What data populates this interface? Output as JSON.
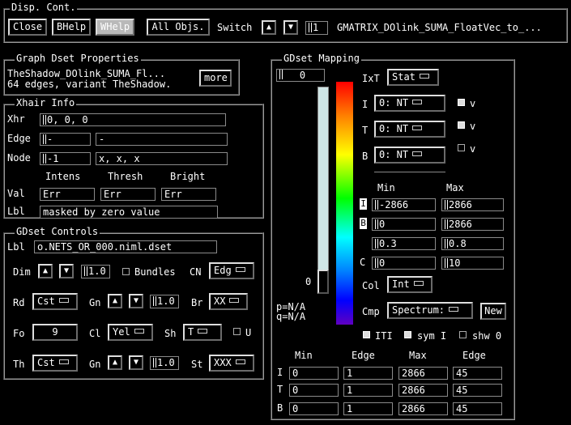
{
  "disp_cont": {
    "title": "Disp. Cont.",
    "close": "Close",
    "bhelp": "BHelp",
    "whelp": "WHelp",
    "all_objs": "All Objs.",
    "switch_label": "Switch",
    "switch_value": "1",
    "dataset_name": "GMATRIX_DOlink_SUMA_FloatVec_to_..."
  },
  "graph_props": {
    "title": "Graph Dset Properties",
    "line1": "TheShadow_DOlink_SUMA_Fl...",
    "line2": "64 edges, variant TheShadow.",
    "more": "more"
  },
  "xhair": {
    "title": "Xhair Info",
    "xhr_label": "Xhr",
    "xhr_value": "0, 0, 0",
    "edge_label": "Edge",
    "edge_value": "-",
    "edge_value2": "-",
    "node_label": "Node",
    "node_value": "-1",
    "node_value2": "x, x, x",
    "intens": "Intens",
    "thresh": "Thresh",
    "bright": "Bright",
    "val_label": "Val",
    "val_intens": "Err",
    "val_thresh": "Err",
    "val_bright": "Err",
    "lbl_label": "Lbl",
    "lbl_value": "masked by zero value"
  },
  "controls": {
    "title": "GDset Controls",
    "lbl_label": "Lbl",
    "lbl_value": "o.NETS_OR_000.niml.dset",
    "dim_label": "Dim",
    "dim_value": "1.0",
    "bundles": "Bundles",
    "cn_label": "CN",
    "cn_value": "Edg",
    "rd_label": "Rd",
    "rd_value": "Cst",
    "gn_label": "Gn",
    "gn_value": "1.0",
    "br_label": "Br",
    "br_value": "XX",
    "fo_label": "Fo",
    "fo_value": "9",
    "cl_label": "Cl",
    "cl_value": "Yel",
    "sh_label": "Sh",
    "sh_value": "T",
    "u_label": "U",
    "th_label": "Th",
    "th_value": "Cst",
    "gn2_label": "Gn",
    "gn2_value": "1.0",
    "st_label": "St",
    "st_value": "XXX"
  },
  "mapping": {
    "title": "GDset Mapping",
    "top_value": "0",
    "slider_value": "0",
    "ixt_label": "IxT",
    "ixt_value": "Stat",
    "i_label": "I",
    "i_value": "0: NT",
    "t_label": "T",
    "t_value": "0: NT",
    "b_label": "B",
    "b_value": "0: NT",
    "v": "v",
    "min_label": "Min",
    "max_label": "Max",
    "i_mark": "I",
    "b_mark": "B",
    "i_min": "-2866",
    "i_max": "2866",
    "b_min": "0",
    "b_max": "2866",
    "b2_min": "0.3",
    "b2_max": "0.8",
    "c_label": "C",
    "c_min": "0",
    "c_max": "10",
    "col_label": "Col",
    "col_value": "Int",
    "cmp_label": "Cmp",
    "cmp_value": "Spectrum:",
    "new": "New",
    "p_value": "p=N/A",
    "q_value": "q=N/A",
    "iti": "ITI",
    "sym_i": "sym I",
    "shw_0": "shw 0",
    "table_headers": [
      "Min",
      "Edge",
      "Max",
      "Edge"
    ],
    "table_rows": [
      {
        "label": "I",
        "cells": [
          "0",
          "1",
          "2866",
          "45"
        ]
      },
      {
        "label": "T",
        "cells": [
          "0",
          "1",
          "2866",
          "45"
        ]
      },
      {
        "label": "B",
        "cells": [
          "0",
          "1",
          "2866",
          "45"
        ]
      }
    ]
  }
}
